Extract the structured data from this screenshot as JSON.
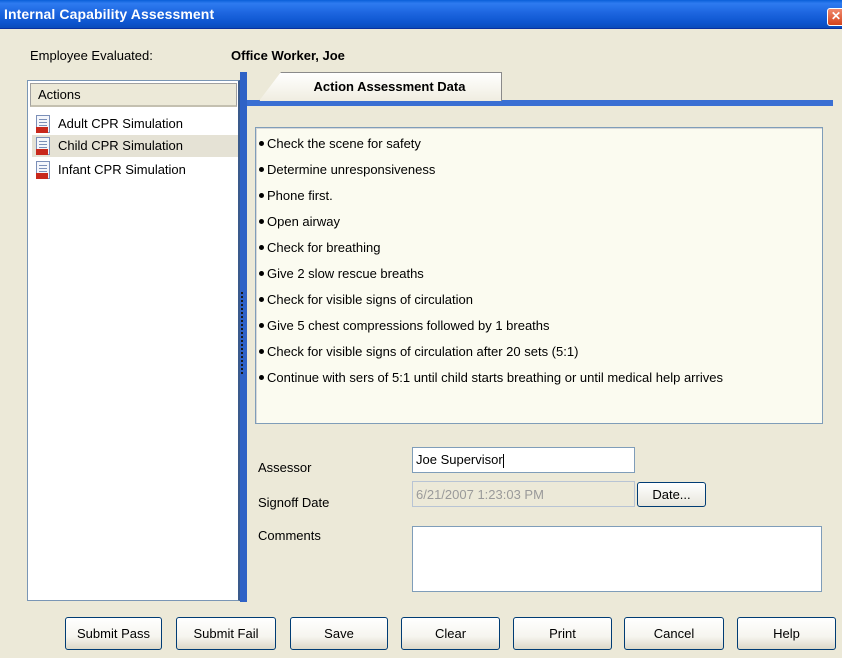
{
  "window": {
    "title": "Internal Capability Assessment",
    "close_glyph": "✕"
  },
  "employee": {
    "label": "Employee Evaluated:",
    "value": "Office Worker, Joe"
  },
  "actions": {
    "header": "Actions",
    "items": [
      {
        "label": "Adult CPR Simulation",
        "icon": "html-document-icon",
        "selected": false
      },
      {
        "label": "Child CPR Simulation",
        "icon": "html-document-icon",
        "selected": true
      },
      {
        "label": "Infant CPR Simulation",
        "icon": "html-document-icon",
        "selected": false
      }
    ]
  },
  "tab": {
    "label": "Action Assessment Data"
  },
  "steps": [
    "Check the scene for safety",
    "Determine unresponsiveness",
    "Phone first.",
    "Open airway",
    "Check for breathing",
    "Give 2 slow rescue breaths",
    "Check for visible signs of circulation",
    "Give 5 chest compressions followed by 1 breaths",
    "Check for visible signs of circulation after 20 sets (5:1)",
    "Continue with sers of 5:1 until child starts breathing or until medical help arrives"
  ],
  "form": {
    "assessor_label": "Assessor",
    "assessor_value": "Joe Supervisor",
    "signoff_label": "Signoff Date",
    "signoff_value": "6/21/2007 1:23:03 PM",
    "date_button": "Date...",
    "comments_label": "Comments",
    "comments_value": ""
  },
  "buttons": {
    "submit_pass": "Submit Pass",
    "submit_fail": "Submit Fail",
    "save": "Save",
    "clear": "Clear",
    "print": "Print",
    "cancel": "Cancel",
    "help": "Help"
  },
  "colors": {
    "title_bar": "#1d66e0",
    "accent": "#2f62c6",
    "window_bg": "#ece9d8"
  }
}
